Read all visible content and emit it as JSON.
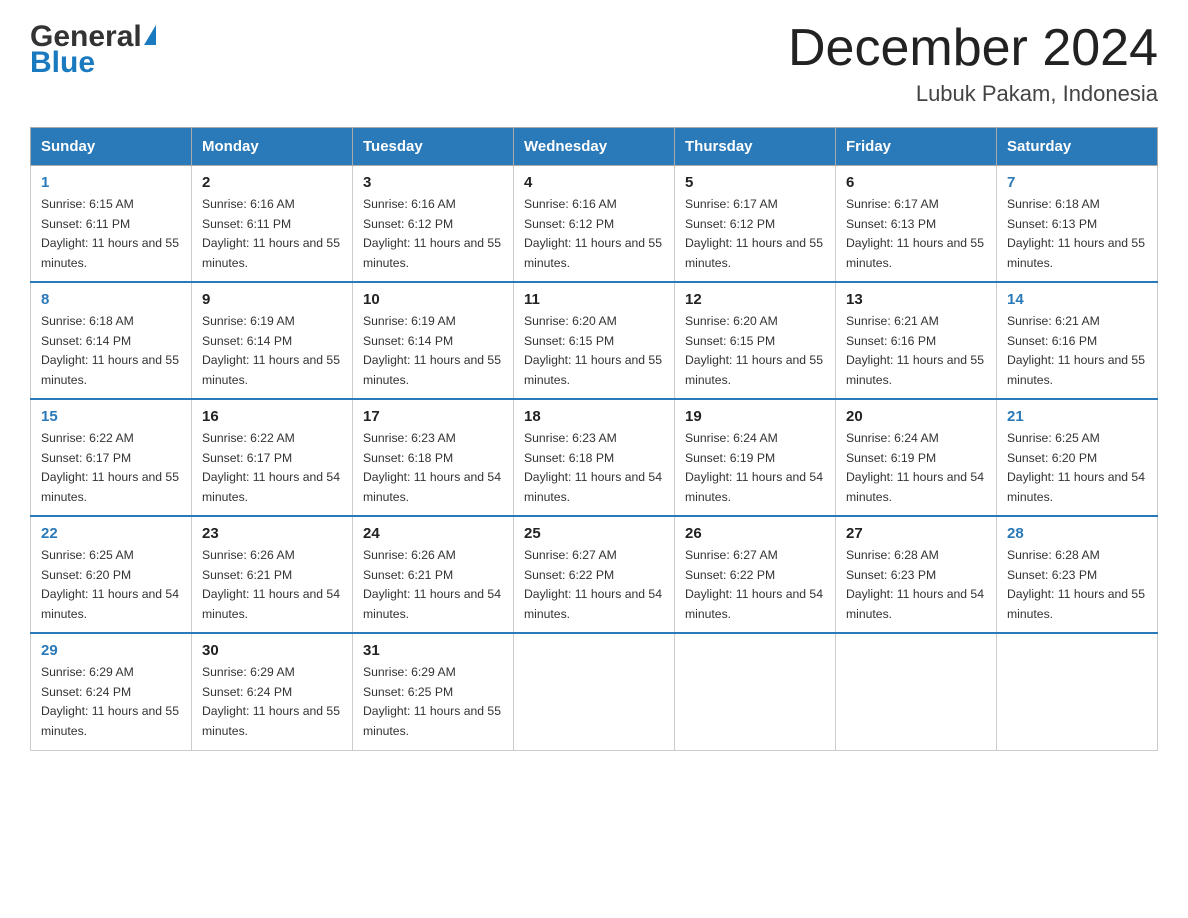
{
  "header": {
    "logo_general": "General",
    "logo_blue": "Blue",
    "month_title": "December 2024",
    "location": "Lubuk Pakam, Indonesia"
  },
  "days_of_week": [
    "Sunday",
    "Monday",
    "Tuesday",
    "Wednesday",
    "Thursday",
    "Friday",
    "Saturday"
  ],
  "weeks": [
    [
      {
        "day": "1",
        "sunrise": "Sunrise: 6:15 AM",
        "sunset": "Sunset: 6:11 PM",
        "daylight": "Daylight: 11 hours and 55 minutes."
      },
      {
        "day": "2",
        "sunrise": "Sunrise: 6:16 AM",
        "sunset": "Sunset: 6:11 PM",
        "daylight": "Daylight: 11 hours and 55 minutes."
      },
      {
        "day": "3",
        "sunrise": "Sunrise: 6:16 AM",
        "sunset": "Sunset: 6:12 PM",
        "daylight": "Daylight: 11 hours and 55 minutes."
      },
      {
        "day": "4",
        "sunrise": "Sunrise: 6:16 AM",
        "sunset": "Sunset: 6:12 PM",
        "daylight": "Daylight: 11 hours and 55 minutes."
      },
      {
        "day": "5",
        "sunrise": "Sunrise: 6:17 AM",
        "sunset": "Sunset: 6:12 PM",
        "daylight": "Daylight: 11 hours and 55 minutes."
      },
      {
        "day": "6",
        "sunrise": "Sunrise: 6:17 AM",
        "sunset": "Sunset: 6:13 PM",
        "daylight": "Daylight: 11 hours and 55 minutes."
      },
      {
        "day": "7",
        "sunrise": "Sunrise: 6:18 AM",
        "sunset": "Sunset: 6:13 PM",
        "daylight": "Daylight: 11 hours and 55 minutes."
      }
    ],
    [
      {
        "day": "8",
        "sunrise": "Sunrise: 6:18 AM",
        "sunset": "Sunset: 6:14 PM",
        "daylight": "Daylight: 11 hours and 55 minutes."
      },
      {
        "day": "9",
        "sunrise": "Sunrise: 6:19 AM",
        "sunset": "Sunset: 6:14 PM",
        "daylight": "Daylight: 11 hours and 55 minutes."
      },
      {
        "day": "10",
        "sunrise": "Sunrise: 6:19 AM",
        "sunset": "Sunset: 6:14 PM",
        "daylight": "Daylight: 11 hours and 55 minutes."
      },
      {
        "day": "11",
        "sunrise": "Sunrise: 6:20 AM",
        "sunset": "Sunset: 6:15 PM",
        "daylight": "Daylight: 11 hours and 55 minutes."
      },
      {
        "day": "12",
        "sunrise": "Sunrise: 6:20 AM",
        "sunset": "Sunset: 6:15 PM",
        "daylight": "Daylight: 11 hours and 55 minutes."
      },
      {
        "day": "13",
        "sunrise": "Sunrise: 6:21 AM",
        "sunset": "Sunset: 6:16 PM",
        "daylight": "Daylight: 11 hours and 55 minutes."
      },
      {
        "day": "14",
        "sunrise": "Sunrise: 6:21 AM",
        "sunset": "Sunset: 6:16 PM",
        "daylight": "Daylight: 11 hours and 55 minutes."
      }
    ],
    [
      {
        "day": "15",
        "sunrise": "Sunrise: 6:22 AM",
        "sunset": "Sunset: 6:17 PM",
        "daylight": "Daylight: 11 hours and 55 minutes."
      },
      {
        "day": "16",
        "sunrise": "Sunrise: 6:22 AM",
        "sunset": "Sunset: 6:17 PM",
        "daylight": "Daylight: 11 hours and 54 minutes."
      },
      {
        "day": "17",
        "sunrise": "Sunrise: 6:23 AM",
        "sunset": "Sunset: 6:18 PM",
        "daylight": "Daylight: 11 hours and 54 minutes."
      },
      {
        "day": "18",
        "sunrise": "Sunrise: 6:23 AM",
        "sunset": "Sunset: 6:18 PM",
        "daylight": "Daylight: 11 hours and 54 minutes."
      },
      {
        "day": "19",
        "sunrise": "Sunrise: 6:24 AM",
        "sunset": "Sunset: 6:19 PM",
        "daylight": "Daylight: 11 hours and 54 minutes."
      },
      {
        "day": "20",
        "sunrise": "Sunrise: 6:24 AM",
        "sunset": "Sunset: 6:19 PM",
        "daylight": "Daylight: 11 hours and 54 minutes."
      },
      {
        "day": "21",
        "sunrise": "Sunrise: 6:25 AM",
        "sunset": "Sunset: 6:20 PM",
        "daylight": "Daylight: 11 hours and 54 minutes."
      }
    ],
    [
      {
        "day": "22",
        "sunrise": "Sunrise: 6:25 AM",
        "sunset": "Sunset: 6:20 PM",
        "daylight": "Daylight: 11 hours and 54 minutes."
      },
      {
        "day": "23",
        "sunrise": "Sunrise: 6:26 AM",
        "sunset": "Sunset: 6:21 PM",
        "daylight": "Daylight: 11 hours and 54 minutes."
      },
      {
        "day": "24",
        "sunrise": "Sunrise: 6:26 AM",
        "sunset": "Sunset: 6:21 PM",
        "daylight": "Daylight: 11 hours and 54 minutes."
      },
      {
        "day": "25",
        "sunrise": "Sunrise: 6:27 AM",
        "sunset": "Sunset: 6:22 PM",
        "daylight": "Daylight: 11 hours and 54 minutes."
      },
      {
        "day": "26",
        "sunrise": "Sunrise: 6:27 AM",
        "sunset": "Sunset: 6:22 PM",
        "daylight": "Daylight: 11 hours and 54 minutes."
      },
      {
        "day": "27",
        "sunrise": "Sunrise: 6:28 AM",
        "sunset": "Sunset: 6:23 PM",
        "daylight": "Daylight: 11 hours and 54 minutes."
      },
      {
        "day": "28",
        "sunrise": "Sunrise: 6:28 AM",
        "sunset": "Sunset: 6:23 PM",
        "daylight": "Daylight: 11 hours and 55 minutes."
      }
    ],
    [
      {
        "day": "29",
        "sunrise": "Sunrise: 6:29 AM",
        "sunset": "Sunset: 6:24 PM",
        "daylight": "Daylight: 11 hours and 55 minutes."
      },
      {
        "day": "30",
        "sunrise": "Sunrise: 6:29 AM",
        "sunset": "Sunset: 6:24 PM",
        "daylight": "Daylight: 11 hours and 55 minutes."
      },
      {
        "day": "31",
        "sunrise": "Sunrise: 6:29 AM",
        "sunset": "Sunset: 6:25 PM",
        "daylight": "Daylight: 11 hours and 55 minutes."
      },
      null,
      null,
      null,
      null
    ]
  ]
}
